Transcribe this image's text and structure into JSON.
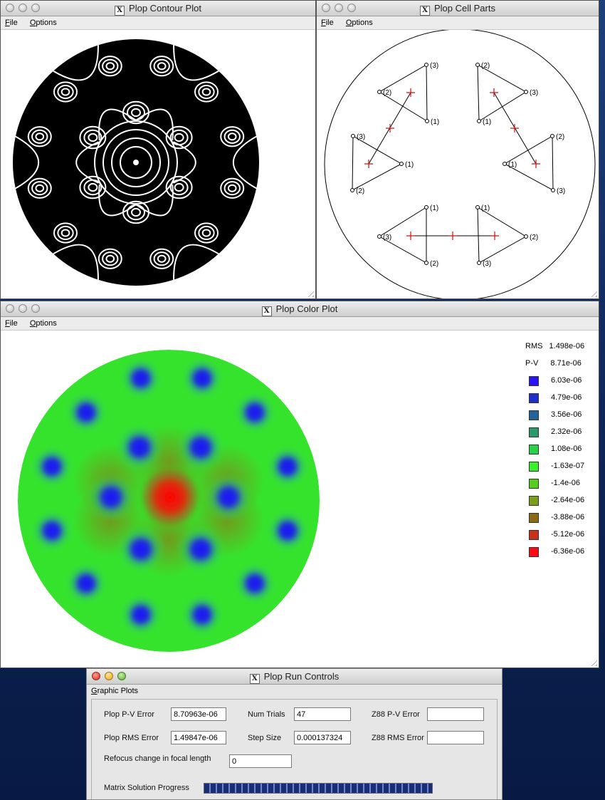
{
  "windows": {
    "contour": {
      "title": "Plop Contour Plot",
      "menu": [
        "File",
        "Options"
      ]
    },
    "cells": {
      "title": "Plop Cell Parts",
      "menu": [
        "File",
        "Options"
      ]
    },
    "color": {
      "title": "Plop Color Plot",
      "menu": [
        "File",
        "Options"
      ]
    },
    "run": {
      "title": "Plop Run Controls",
      "menu": [
        "Graphic Plots"
      ]
    }
  },
  "x_logo": "X",
  "cells": {
    "labels": [
      "(1)",
      "(2)",
      "(3)"
    ],
    "marker_color": "#d01010"
  },
  "color_plot": {
    "rms_label": "RMS",
    "rms_value": "1.498e-06",
    "pv_label": "P-V",
    "pv_value": "8.71e-06",
    "legend": [
      {
        "value": "6.03e-06",
        "color": "#2a14f2"
      },
      {
        "value": "4.79e-06",
        "color": "#1f2fc9"
      },
      {
        "value": "3.56e-06",
        "color": "#22649a"
      },
      {
        "value": "2.32e-06",
        "color": "#2a9a6a"
      },
      {
        "value": "1.08e-06",
        "color": "#2ad04a"
      },
      {
        "value": "-1.63e-07",
        "color": "#3af02a"
      },
      {
        "value": "-1.4e-06",
        "color": "#55cc1e"
      },
      {
        "value": "-2.64e-06",
        "color": "#7a9e1a"
      },
      {
        "value": "-3.88e-06",
        "color": "#8a6a14"
      },
      {
        "value": "-5.12e-06",
        "color": "#c8301a"
      },
      {
        "value": "-6.36e-06",
        "color": "#ff0a14"
      }
    ]
  },
  "run_controls": {
    "plop_pv_error_label": "Plop P-V Error",
    "plop_pv_error_value": "8.70963e-06",
    "num_trials_label": "Num Trials",
    "num_trials_value": "47",
    "z88_pv_error_label": "Z88 P-V Error",
    "z88_pv_error_value": "",
    "plop_rms_error_label": "Plop RMS Error",
    "plop_rms_error_value": "1.49847e-06",
    "step_size_label": "Step Size",
    "step_size_value": "0.000137324",
    "z88_rms_error_label": "Z88 RMS Error",
    "z88_rms_error_value": "",
    "refocus_label": "Refocus change in focal length",
    "refocus_value": "0",
    "matrix_progress_label": "Matrix Solution Progress",
    "matrix_progress_fraction": 1.0
  }
}
